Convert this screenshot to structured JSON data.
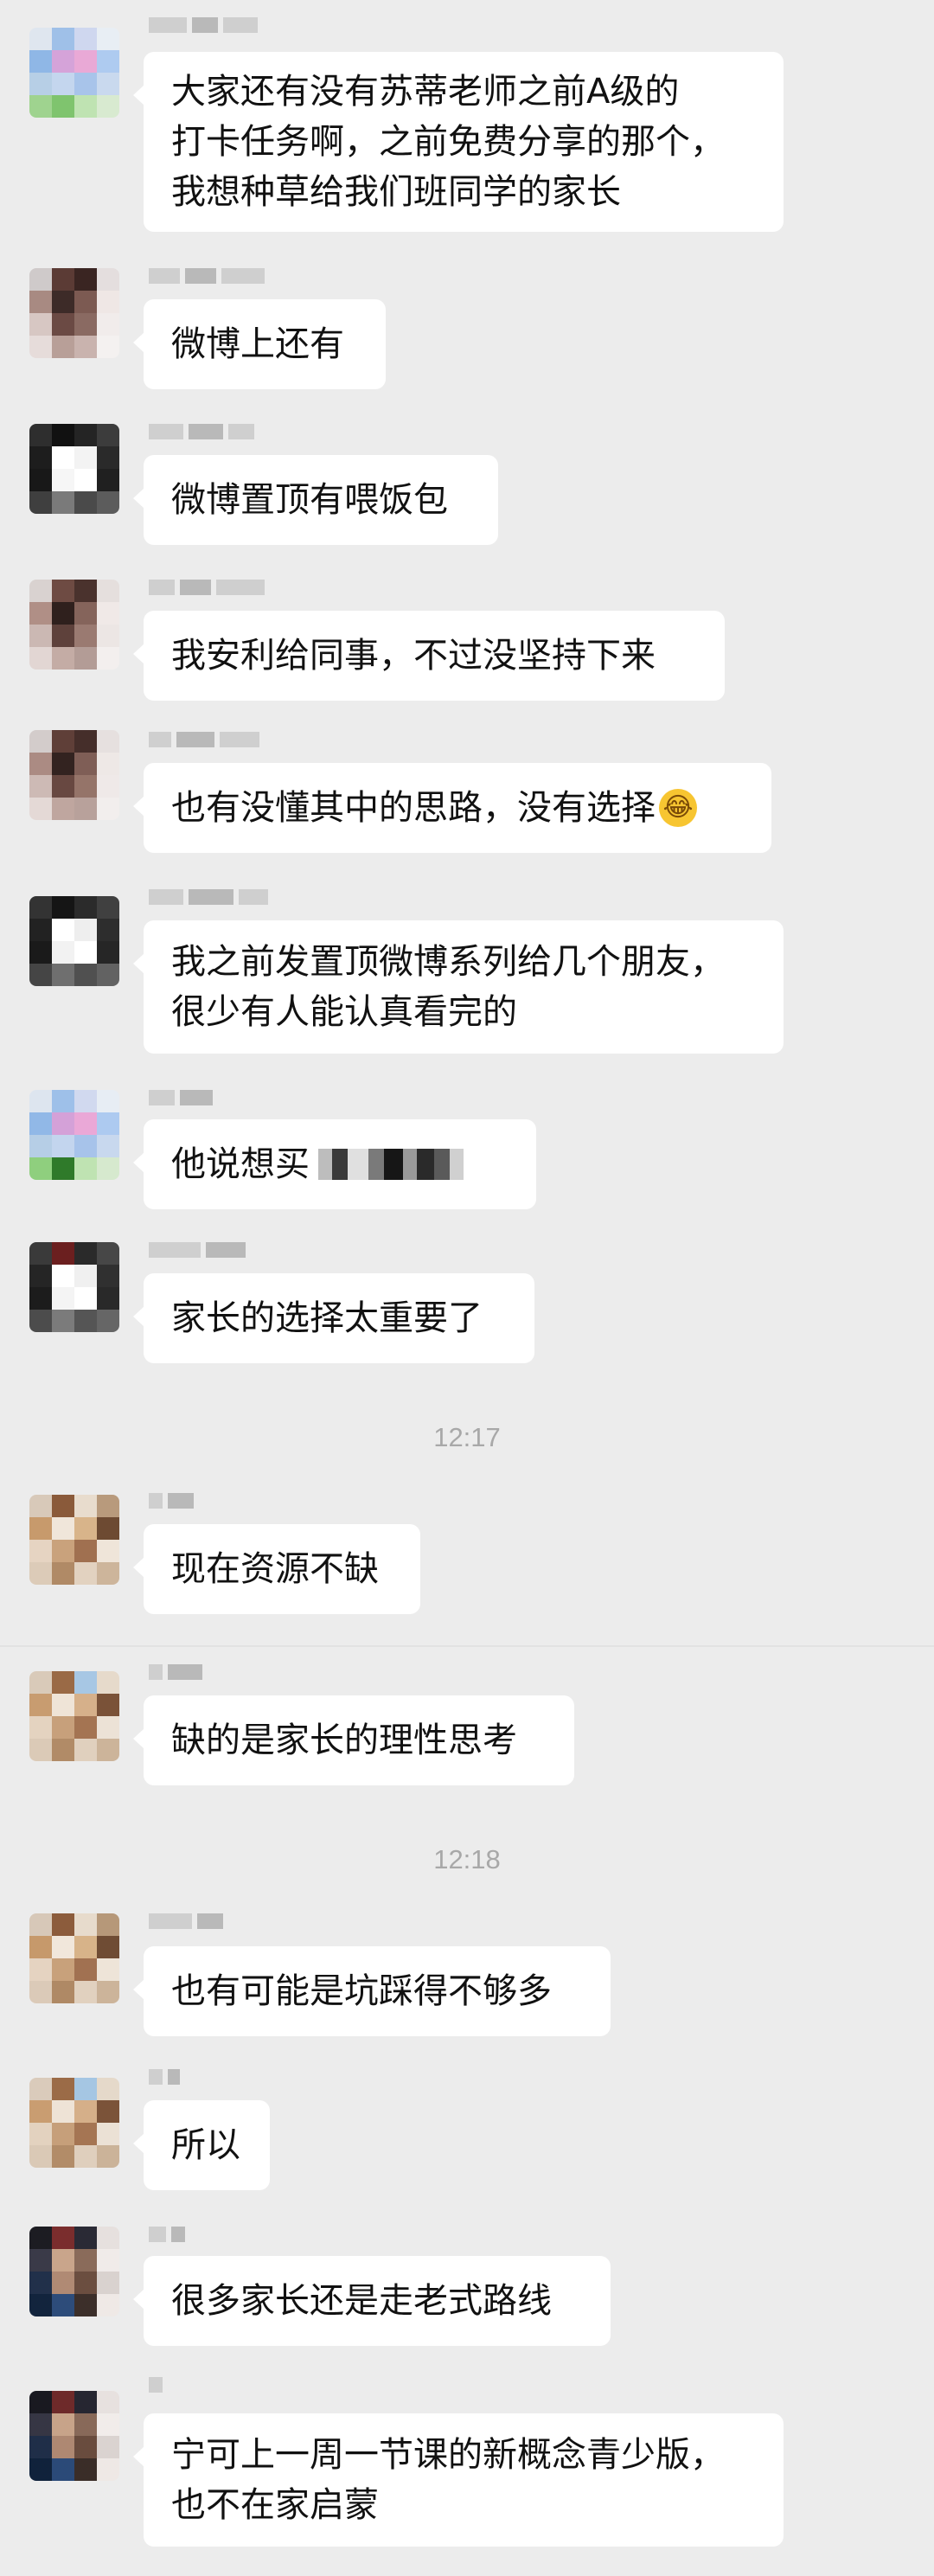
{
  "messages": [
    {
      "text": "大家还有没有苏蒂老师之前A级的\n打卡任务啊，之前免费分享的那个，\n我想种草给我们班同学的家长",
      "avatar": "flower-avatar",
      "avatar_colors": [
        "#dfe6ef",
        "#9fc0e8",
        "#cfd7ef",
        "#e8eef4",
        "#8fb7e6",
        "#d5a3d9",
        "#e9a9d6",
        "#aecbf0",
        "#b7cfe6",
        "#c4d6ee",
        "#a8c4ea",
        "#c9d9ee",
        "#9fd38f",
        "#7fc46e",
        "#bfe3b2",
        "#d8ead0"
      ]
    },
    {
      "text": "微博上还有",
      "avatar": "person-avatar",
      "avatar_colors": [
        "#cfcaca",
        "#5b3b35",
        "#3a2522",
        "#e4dede",
        "#a88a82",
        "#3d2b28",
        "#7c5a52",
        "#efe7e5",
        "#d7c7c3",
        "#6b4a44",
        "#8a6a62",
        "#f1eceb",
        "#e6dcda",
        "#b89f98",
        "#c9b3ae",
        "#f4f1f0"
      ]
    },
    {
      "text": "微博置顶有喂饭包",
      "avatar": "dark-frame-avatar",
      "avatar_colors": [
        "#2e2e2e",
        "#111111",
        "#242424",
        "#3c3c3c",
        "#1d1d1d",
        "#ffffff",
        "#f3f3f3",
        "#2a2a2a",
        "#181818",
        "#f6f6f6",
        "#ffffff",
        "#202020",
        "#3f3f3f",
        "#7a7a7a",
        "#4a4a4a",
        "#5c5c5c"
      ]
    },
    {
      "text": "我安利给同事，不过没坚持下来",
      "avatar": "person-avatar-2",
      "avatar_colors": [
        "#d9d2d0",
        "#6e4b43",
        "#4a322d",
        "#e5dfdd",
        "#b08f86",
        "#2f201d",
        "#85645b",
        "#f0e9e7",
        "#cbb8b3",
        "#5e413b",
        "#9a7a71",
        "#ece6e4",
        "#e2d6d3",
        "#c4aca5",
        "#b39c96",
        "#f3efee"
      ]
    },
    {
      "text": "也有没懂其中的思路，没有选择",
      "emoji": "😂",
      "avatar": "person-avatar-3",
      "avatar_colors": [
        "#d3cccb",
        "#5f3f38",
        "#452e2a",
        "#e6e0df",
        "#ab8b83",
        "#332320",
        "#7f5e56",
        "#eee8e6",
        "#cdbab5",
        "#684841",
        "#957469",
        "#efe9e8",
        "#e4d9d6",
        "#bfa69f",
        "#b8a19b",
        "#f2eeed"
      ]
    },
    {
      "text": "我之前发置顶微博系列给几个朋友，\n很少有人能认真看完的",
      "avatar": "dark-frame-avatar-2",
      "avatar_colors": [
        "#333333",
        "#151515",
        "#2b2b2b",
        "#404040",
        "#222222",
        "#ffffff",
        "#eeeeee",
        "#2d2d2d",
        "#1a1a1a",
        "#f2f2f2",
        "#ffffff",
        "#262626",
        "#454545",
        "#6f6f6f",
        "#505050",
        "#626262"
      ]
    },
    {
      "text": "他说想买",
      "pixel_note": "redacted",
      "avatar": "flower-avatar-2",
      "avatar_colors": [
        "#dde5ef",
        "#9ec0e9",
        "#d1d9ef",
        "#e7edf4",
        "#91b8e7",
        "#d4a1d8",
        "#eaa8d7",
        "#adcaf0",
        "#b6cee6",
        "#c3d5ee",
        "#a7c3ea",
        "#c8d8ee",
        "#8fcf7e",
        "#2f7a2a",
        "#bfe3b2",
        "#d6e9ce"
      ]
    },
    {
      "text": "家长的选择太重要了",
      "avatar": "dark-frame-avatar-3",
      "avatar_colors": [
        "#3a3a3a",
        "#6b1f1f",
        "#2a2a2a",
        "#474747",
        "#252525",
        "#ffffff",
        "#f0f0f0",
        "#303030",
        "#1c1c1c",
        "#f4f4f4",
        "#ffffff",
        "#292929",
        "#4c4c4c",
        "#7b7b7b",
        "#555555",
        "#666666"
      ]
    },
    {
      "text": "现在资源不缺",
      "avatar": "colorful-avatar",
      "avatar_colors": [
        "#d8c9b9",
        "#8a5a3a",
        "#e8dccd",
        "#b89a7c",
        "#c79a6c",
        "#f0e6da",
        "#d8b48a",
        "#6d4a32",
        "#e6d4c2",
        "#c9a27c",
        "#a07050",
        "#efe5d9",
        "#dccbb8",
        "#b08a66",
        "#e2d2c0",
        "#cdb59b"
      ]
    },
    {
      "text": "缺的是家长的理性思考",
      "avatar": "colorful-avatar-2",
      "avatar_colors": [
        "#d9cab9",
        "#9a6a46",
        "#a7c7e4",
        "#e6dacb",
        "#c89c70",
        "#efe4d7",
        "#d6b08a",
        "#7a5238",
        "#e4d3c0",
        "#c7a07b",
        "#a47452",
        "#ece2d6",
        "#dbcab7",
        "#b18b67",
        "#e0d0be",
        "#ccb49a"
      ]
    },
    {
      "text": "也有可能是坑踩得不够多",
      "avatar": "colorful-avatar-3",
      "avatar_colors": [
        "#d7c8b8",
        "#8c5c3c",
        "#e7dbcc",
        "#b69879",
        "#c6996b",
        "#f1e7db",
        "#d7b389",
        "#6f4c34",
        "#e5d3c1",
        "#c8a17b",
        "#a17151",
        "#eee4d8",
        "#dbcab8",
        "#af8965",
        "#e1d1bf",
        "#ccb49a"
      ]
    },
    {
      "text": "所以",
      "avatar": "colorful-avatar-4",
      "avatar_colors": [
        "#dacbbb",
        "#9b6b47",
        "#a5c6e3",
        "#e5d9ca",
        "#c99d71",
        "#eee3d6",
        "#d5af89",
        "#7b5339",
        "#e3d2bf",
        "#c69f7a",
        "#a57553",
        "#ebe1d5",
        "#dac9b6",
        "#b28c68",
        "#dfcfbd",
        "#cbb399"
      ]
    },
    {
      "text": "很多家长还是走老式路线",
      "avatar": "photo-avatar",
      "avatar_colors": [
        "#1c1c22",
        "#7a2d2d",
        "#2a2a35",
        "#e6e0de",
        "#3a3a48",
        "#c9a58b",
        "#8a6b5a",
        "#f0ebe9",
        "#21304a",
        "#b08a74",
        "#6b4e40",
        "#d9d2cf",
        "#12243d",
        "#2d4c7a",
        "#3c2f2a",
        "#efe9e6"
      ]
    },
    {
      "text": "宁可上一周一节课的新概念青少版，\n也不在家启蒙",
      "avatar": "photo-avatar-2",
      "avatar_colors": [
        "#191920",
        "#6e2a2a",
        "#262631",
        "#e7e1df",
        "#363644",
        "#c7a389",
        "#886959",
        "#f1ecea",
        "#1f2e48",
        "#ae8872",
        "#694c3e",
        "#dad3d0",
        "#10223b",
        "#2b4a78",
        "#3a2d28",
        "#eee8e5"
      ]
    }
  ],
  "timestamps": [
    "12:17",
    "12:18"
  ]
}
